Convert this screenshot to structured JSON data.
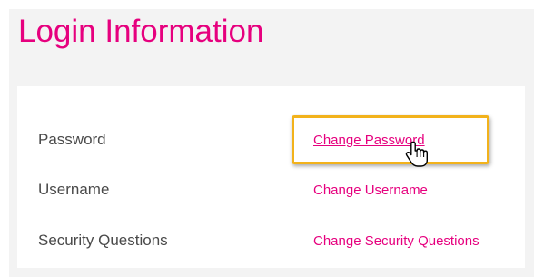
{
  "page": {
    "title": "Login Information"
  },
  "rows": [
    {
      "label": "Password",
      "link": "Change Password"
    },
    {
      "label": "Username",
      "link": "Change Username"
    },
    {
      "label": "Security Questions",
      "link": "Change Security Questions"
    }
  ],
  "colors": {
    "accent": "#e6007e",
    "highlight": "#f2b21b",
    "label_text": "#4a4a4a",
    "panel_bg": "#f3f3f3"
  },
  "icons": {
    "cursor": "hand-pointer-icon"
  }
}
